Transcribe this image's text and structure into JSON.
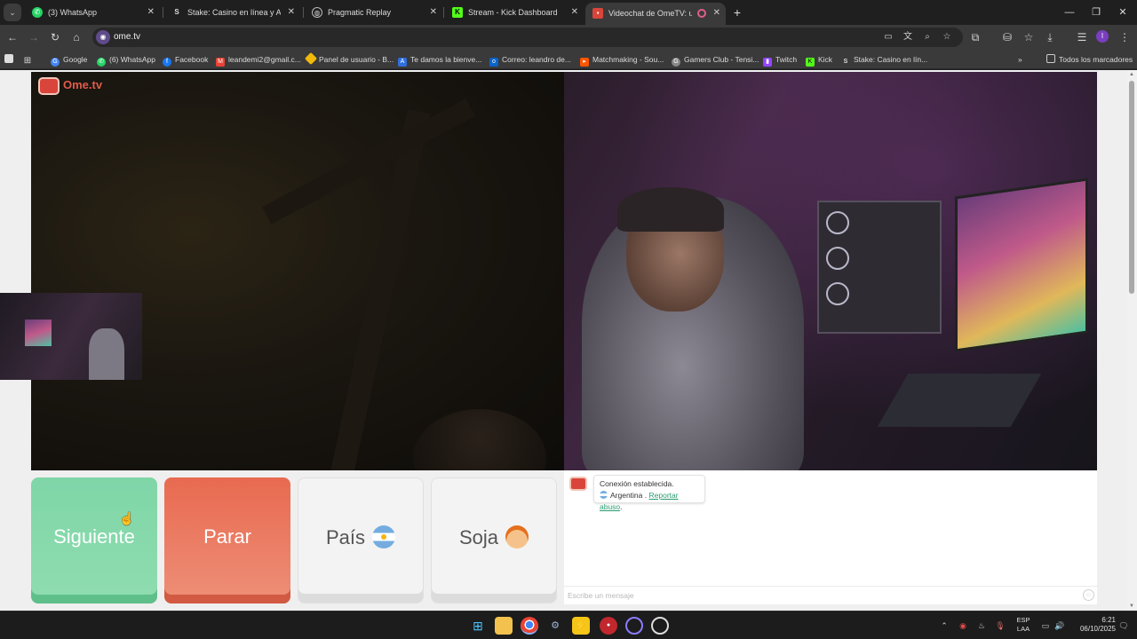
{
  "browser": {
    "tabs": [
      {
        "title": "(3) WhatsApp",
        "icon": "whatsapp-icon",
        "color": "#25d366"
      },
      {
        "title": "Stake: Casino en línea y Apuest",
        "icon": "stake-icon",
        "color": "#dcdcdc"
      },
      {
        "title": "Pragmatic Replay",
        "icon": "globe-icon",
        "color": "#dcdcdc"
      },
      {
        "title": "Stream - Kick Dashboard",
        "icon": "kick-icon",
        "color": "#53fc18"
      },
      {
        "title": "Videochat de OmeTV: una",
        "icon": "ometv-icon",
        "color": "#d9453b",
        "active": true
      }
    ],
    "url": "ome.tv",
    "bookmarks": [
      {
        "label": "Google",
        "icon": "google-icon",
        "color": "#4285f4"
      },
      {
        "label": "(6) WhatsApp",
        "icon": "whatsapp-icon",
        "color": "#25d366"
      },
      {
        "label": "Facebook",
        "icon": "facebook-icon",
        "color": "#1877f2"
      },
      {
        "label": "leandemi2@gmail.c...",
        "icon": "gmail-icon",
        "color": "#ea4335"
      },
      {
        "label": "Panel de usuario - B...",
        "icon": "binance-icon",
        "color": "#f0b90b"
      },
      {
        "label": "Te damos la bienve...",
        "icon": "letter-a-icon",
        "color": "#2f6fde"
      },
      {
        "label": "Correo: leandro de...",
        "icon": "outlook-icon",
        "color": "#0a64c8"
      },
      {
        "label": "Matchmaking - Sou...",
        "icon": "faceit-icon",
        "color": "#ff5500"
      },
      {
        "label": "Gamers Club - Tensi...",
        "icon": "gamersclub-icon",
        "color": "#888888"
      },
      {
        "label": "Twitch",
        "icon": "twitch-icon",
        "color": "#9146ff"
      },
      {
        "label": "Kick",
        "icon": "kick-icon",
        "color": "#53fc18"
      },
      {
        "label": "Stake: Casino en lín...",
        "icon": "stake-icon",
        "color": "#cccccc"
      }
    ],
    "all_bookmarks": "Todos los marcadores",
    "profile_initial": "I"
  },
  "site": {
    "logo_text": "Ome.tv",
    "buttons": {
      "next": "Siguiente",
      "stop": "Parar",
      "country": "País",
      "gender": "Soja"
    },
    "chat": {
      "status": "Conexión establecida.",
      "country": "Argentina",
      "separator": ".",
      "report": "Reportar abuso",
      "report_end": ".",
      "placeholder": "Escribe un mensaje"
    }
  },
  "taskbar": {
    "lang_top": "ESP",
    "lang_bottom": "LAA",
    "time": "6:21",
    "date": "06/10/2025"
  },
  "colors": {
    "next_button": "#8fdcb0",
    "stop_button": "#ee8f78",
    "accent_ometv": "#d9453b",
    "report_link": "#2a9d6f"
  }
}
